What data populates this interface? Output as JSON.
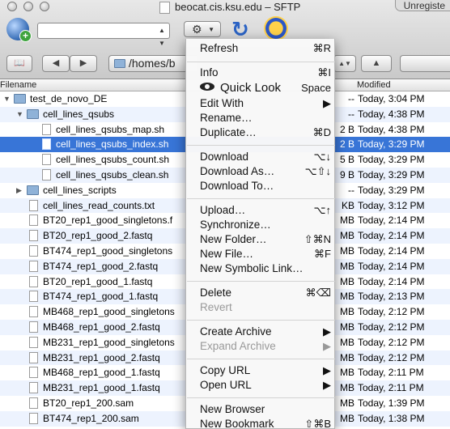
{
  "window": {
    "title": "beocat.cis.ksu.edu – SFTP",
    "unregistered": "Unregiste"
  },
  "toolbar": {
    "address_placeholder": "",
    "path": "/homes/b"
  },
  "columns": {
    "filename": "Filename",
    "modified": "Modified"
  },
  "files": [
    {
      "name": "test_de_novo_DE",
      "kind": "folder",
      "depth": 0,
      "expanded": true,
      "size": "--",
      "modified": "Today, 3:04 PM"
    },
    {
      "name": "cell_lines_qsubs",
      "kind": "folder",
      "depth": 1,
      "expanded": true,
      "size": "--",
      "modified": "Today, 4:38 PM"
    },
    {
      "name": "cell_lines_qsubs_map.sh",
      "kind": "file",
      "depth": 2,
      "size": "2 B",
      "modified": "Today, 4:38 PM"
    },
    {
      "name": "cell_lines_qsubs_index.sh",
      "kind": "file",
      "depth": 2,
      "size": "2 B",
      "modified": "Today, 3:29 PM",
      "selected": true
    },
    {
      "name": "cell_lines_qsubs_count.sh",
      "kind": "file",
      "depth": 2,
      "size": "5 B",
      "modified": "Today, 3:29 PM"
    },
    {
      "name": "cell_lines_qsubs_clean.sh",
      "kind": "file",
      "depth": 2,
      "size": "9 B",
      "modified": "Today, 3:29 PM"
    },
    {
      "name": "cell_lines_scripts",
      "kind": "folder",
      "depth": 1,
      "expanded": false,
      "size": "--",
      "modified": "Today, 3:29 PM"
    },
    {
      "name": "cell_lines_read_counts.txt",
      "kind": "file",
      "depth": 1,
      "size": "KB",
      "modified": "Today, 3:12 PM"
    },
    {
      "name": "BT20_rep1_good_singletons.f",
      "kind": "file",
      "depth": 1,
      "size": "MB",
      "modified": "Today, 2:14 PM"
    },
    {
      "name": "BT20_rep1_good_2.fastq",
      "kind": "file",
      "depth": 1,
      "size": "MB",
      "modified": "Today, 2:14 PM"
    },
    {
      "name": "BT474_rep1_good_singletons",
      "kind": "file",
      "depth": 1,
      "size": "MB",
      "modified": "Today, 2:14 PM"
    },
    {
      "name": "BT474_rep1_good_2.fastq",
      "kind": "file",
      "depth": 1,
      "size": "MB",
      "modified": "Today, 2:14 PM"
    },
    {
      "name": "BT20_rep1_good_1.fastq",
      "kind": "file",
      "depth": 1,
      "size": "MB",
      "modified": "Today, 2:14 PM"
    },
    {
      "name": "BT474_rep1_good_1.fastq",
      "kind": "file",
      "depth": 1,
      "size": "MB",
      "modified": "Today, 2:13 PM"
    },
    {
      "name": "MB468_rep1_good_singletons",
      "kind": "file",
      "depth": 1,
      "size": "MB",
      "modified": "Today, 2:12 PM"
    },
    {
      "name": "MB468_rep1_good_2.fastq",
      "kind": "file",
      "depth": 1,
      "size": "MB",
      "modified": "Today, 2:12 PM"
    },
    {
      "name": "MB231_rep1_good_singletons",
      "kind": "file",
      "depth": 1,
      "size": "MB",
      "modified": "Today, 2:12 PM"
    },
    {
      "name": "MB231_rep1_good_2.fastq",
      "kind": "file",
      "depth": 1,
      "size": "MB",
      "modified": "Today, 2:12 PM"
    },
    {
      "name": "MB468_rep1_good_1.fastq",
      "kind": "file",
      "depth": 1,
      "size": "MB",
      "modified": "Today, 2:11 PM"
    },
    {
      "name": "MB231_rep1_good_1.fastq",
      "kind": "file",
      "depth": 1,
      "size": "MB",
      "modified": "Today, 2:11 PM"
    },
    {
      "name": "BT20_rep1_200.sam",
      "kind": "file",
      "depth": 1,
      "size": "MB",
      "modified": "Today, 1:39 PM"
    },
    {
      "name": "BT474_rep1_200.sam",
      "kind": "file",
      "depth": 1,
      "size": "MB",
      "modified": "Today, 1:38 PM"
    }
  ],
  "menu": {
    "refresh": {
      "label": "Refresh",
      "shortcut": "⌘R"
    },
    "info": {
      "label": "Info",
      "shortcut": "⌘I"
    },
    "quick_look": {
      "label": "Quick Look",
      "shortcut": "Space"
    },
    "edit_with": {
      "label": "Edit With"
    },
    "rename": {
      "label": "Rename…"
    },
    "duplicate": {
      "label": "Duplicate…",
      "shortcut": "⌘D"
    },
    "download": {
      "label": "Download",
      "shortcut": "⌥↓"
    },
    "download_as": {
      "label": "Download As…",
      "shortcut": "⌥⇧↓"
    },
    "download_to": {
      "label": "Download To…"
    },
    "upload": {
      "label": "Upload…",
      "shortcut": "⌥↑"
    },
    "synchronize": {
      "label": "Synchronize…"
    },
    "new_folder": {
      "label": "New Folder…",
      "shortcut": "⇧⌘N"
    },
    "new_file": {
      "label": "New File…",
      "shortcut": "⌘F"
    },
    "new_symlink": {
      "label": "New Symbolic Link…"
    },
    "delete": {
      "label": "Delete",
      "shortcut": "⌘⌫"
    },
    "revert": {
      "label": "Revert"
    },
    "create_archive": {
      "label": "Create Archive"
    },
    "expand_archive": {
      "label": "Expand Archive"
    },
    "copy_url": {
      "label": "Copy URL"
    },
    "open_url": {
      "label": "Open URL"
    },
    "new_browser": {
      "label": "New Browser"
    },
    "new_bookmark": {
      "label": "New Bookmark",
      "shortcut": "⇧⌘B"
    }
  }
}
